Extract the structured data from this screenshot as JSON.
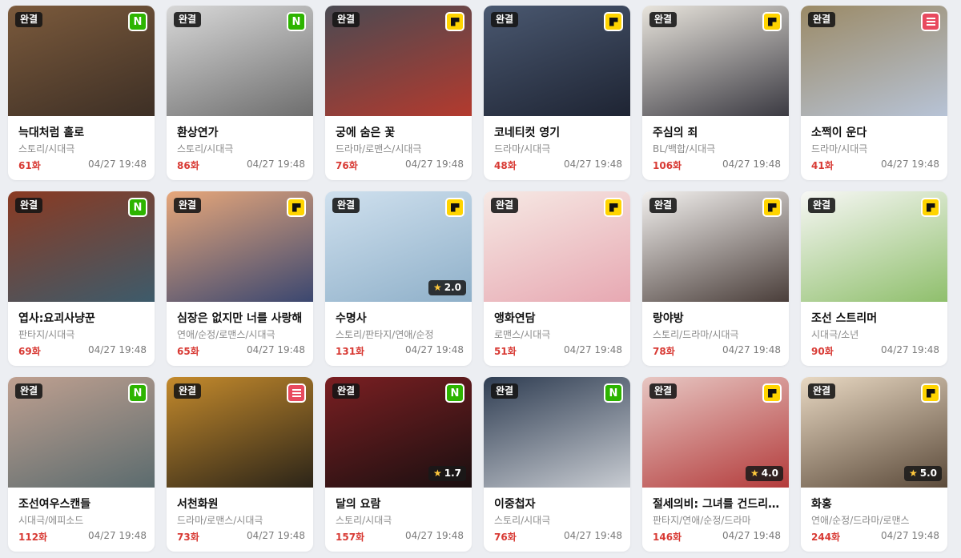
{
  "cards": [
    {
      "badge": "완결",
      "platform": "naver",
      "platform_label": "N",
      "title": "늑대처럼 홀로",
      "genre": "스토리/시대극",
      "episodes": "61화",
      "date": "04/27 19:48",
      "rating": null,
      "colors": [
        "#7b5a3c",
        "#3d2f25"
      ]
    },
    {
      "badge": "완결",
      "platform": "naver",
      "platform_label": "N",
      "title": "환상연가",
      "genre": "스토리/시대극",
      "episodes": "86화",
      "date": "04/27 19:48",
      "rating": null,
      "colors": [
        "#d8d8d8",
        "#6e6e6e"
      ]
    },
    {
      "badge": "완결",
      "platform": "kakao",
      "platform_label": "",
      "title": "궁에 숨은 꽃",
      "genre": "드라마/로맨스/시대극",
      "episodes": "76화",
      "date": "04/27 19:48",
      "rating": null,
      "colors": [
        "#4a4a52",
        "#b33a2e"
      ]
    },
    {
      "badge": "완결",
      "platform": "kakao",
      "platform_label": "",
      "title": "코네티컷 영기",
      "genre": "드라마/시대극",
      "episodes": "48화",
      "date": "04/27 19:48",
      "rating": null,
      "colors": [
        "#4a5870",
        "#1e2433"
      ]
    },
    {
      "badge": "완결",
      "platform": "kakao",
      "platform_label": "",
      "title": "주심의 죄",
      "genre": "BL/백합/시대극",
      "episodes": "106화",
      "date": "04/27 19:48",
      "rating": null,
      "colors": [
        "#e8e4dc",
        "#3b3a42"
      ]
    },
    {
      "badge": "완결",
      "platform": "ridi",
      "platform_label": "",
      "title": "소쩍이 운다",
      "genre": "드라마/시대극",
      "episodes": "41화",
      "date": "04/27 19:48",
      "rating": null,
      "colors": [
        "#9b8a66",
        "#b7c3d6"
      ]
    },
    {
      "badge": "완결",
      "platform": "naver",
      "platform_label": "N",
      "title": "엽사:요괴사냥꾼",
      "genre": "판타지/시대극",
      "episodes": "69화",
      "date": "04/27 19:48",
      "rating": null,
      "colors": [
        "#8a3a22",
        "#3d5b6b"
      ]
    },
    {
      "badge": "완결",
      "platform": "kakao",
      "platform_label": "",
      "title": "심장은 없지만 너를 사랑해",
      "genre": "연애/순정/로맨스/시대극",
      "episodes": "65화",
      "date": "04/27 19:48",
      "rating": null,
      "colors": [
        "#e7a77a",
        "#3b4770"
      ]
    },
    {
      "badge": "완결",
      "platform": "kakao",
      "platform_label": "",
      "title": "수명사",
      "genre": "스토리/판타지/연애/순정",
      "episodes": "131화",
      "date": "04/27 19:48",
      "rating": "2.0",
      "colors": [
        "#cfe0ee",
        "#8fb0c9"
      ]
    },
    {
      "badge": "완결",
      "platform": "kakao",
      "platform_label": "",
      "title": "앵화연담",
      "genre": "로맨스/시대극",
      "episodes": "51화",
      "date": "04/27 19:48",
      "rating": null,
      "colors": [
        "#f6e9e4",
        "#e7a8b2"
      ]
    },
    {
      "badge": "완결",
      "platform": "kakao",
      "platform_label": "",
      "title": "랑야방",
      "genre": "스토리/드라마/시대극",
      "episodes": "78화",
      "date": "04/27 19:48",
      "rating": null,
      "colors": [
        "#f2f0ee",
        "#4a3e3a"
      ]
    },
    {
      "badge": "완결",
      "platform": "kakao",
      "platform_label": "",
      "title": "조선 스트리머",
      "genre": "시대극/소년",
      "episodes": "90화",
      "date": "04/27 19:48",
      "rating": null,
      "colors": [
        "#f7f7f5",
        "#8fbf6c"
      ]
    },
    {
      "badge": "완결",
      "platform": "naver",
      "platform_label": "N",
      "title": "조선여우스캔들",
      "genre": "시대극/에피소드",
      "episodes": "112화",
      "date": "04/27 19:48",
      "rating": null,
      "colors": [
        "#bfa090",
        "#5b6b6e"
      ]
    },
    {
      "badge": "완결",
      "platform": "ridi",
      "platform_label": "",
      "title": "서천화원",
      "genre": "드라마/로맨스/시대극",
      "episodes": "73화",
      "date": "04/27 19:48",
      "rating": null,
      "colors": [
        "#c48a2c",
        "#2b2418"
      ]
    },
    {
      "badge": "완결",
      "platform": "naver",
      "platform_label": "N",
      "title": "달의 요람",
      "genre": "스토리/시대극",
      "episodes": "157화",
      "date": "04/27 19:48",
      "rating": "1.7",
      "colors": [
        "#7a1f22",
        "#1a0f10"
      ]
    },
    {
      "badge": "완결",
      "platform": "naver",
      "platform_label": "N",
      "title": "이중첩자",
      "genre": "스토리/시대극",
      "episodes": "76화",
      "date": "04/27 19:48",
      "rating": null,
      "colors": [
        "#2f3d52",
        "#c8ccd2"
      ]
    },
    {
      "badge": "완결",
      "platform": "kakao",
      "platform_label": "",
      "title": "절세의비: 그녀를 건드리지 마",
      "genre": "판타지/연애/순정/드라마",
      "episodes": "146화",
      "date": "04/27 19:48",
      "rating": "4.0",
      "colors": [
        "#e7c6c2",
        "#b33b3b"
      ]
    },
    {
      "badge": "완결",
      "platform": "kakao",
      "platform_label": "",
      "title": "화홍",
      "genre": "연애/순정/드라마/로맨스",
      "episodes": "244화",
      "date": "04/27 19:48",
      "rating": "5.0",
      "colors": [
        "#e8d8c2",
        "#5b4a3a"
      ]
    }
  ]
}
